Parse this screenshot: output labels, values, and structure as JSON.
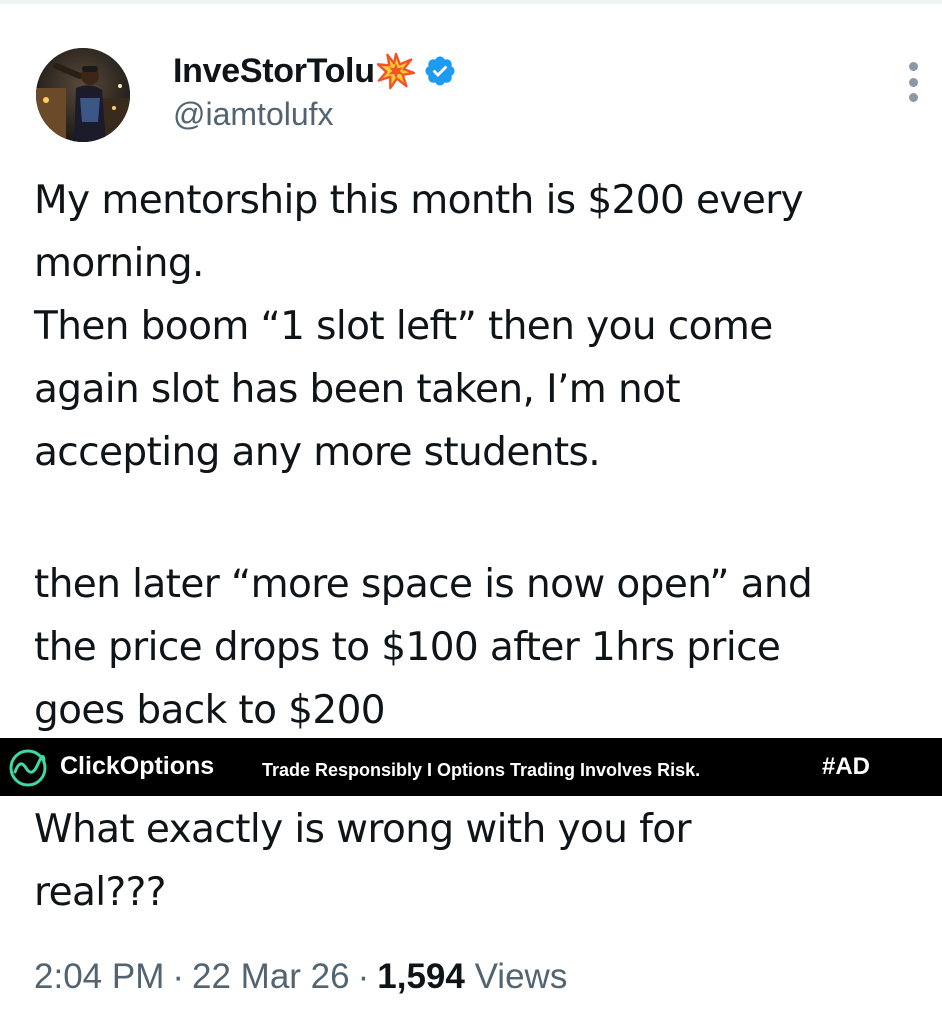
{
  "tweet": {
    "author": {
      "display_name": "InveStorTolu",
      "name_emoji": "collision-emoji",
      "verified": true,
      "handle": "@iamtolufx"
    },
    "text_paragraph_1": "My mentorship this month is $200 every\nmorning.\nThen boom “1 slot left” then you come\nagain slot has been taken, I’m not\naccepting any more students.",
    "text_paragraph_2": "then later “more space is now open” and\nthe price drops to $100 after 1hrs price\ngoes back to $200",
    "text_paragraph_3": "What exactly is wrong with you for\nreal???",
    "time": "2:04 PM",
    "separator": "·",
    "date": "22 Mar 26",
    "views_count": "1,594",
    "views_label": "Views"
  },
  "ad_banner": {
    "brand": "ClickOptions",
    "disclaimer": "Trade Responsibly  I  Options Trading Involves Risk.",
    "tag": "#AD",
    "icon": "clickoptions-logo-icon"
  },
  "icons": {
    "more": "more-options-icon",
    "verified": "verified-badge-icon",
    "avatar": "profile-photo"
  },
  "colors": {
    "text_primary": "#0f1419",
    "text_secondary": "#536471",
    "verified_blue": "#1d9bf0",
    "ad_background": "#000000",
    "ad_logo_green": "#3fd9a6"
  }
}
